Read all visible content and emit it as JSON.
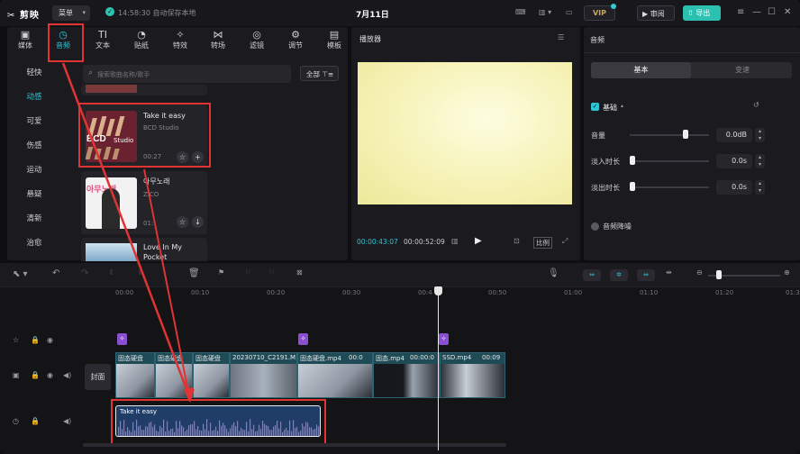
{
  "app": {
    "logo": "✂ 剪映",
    "menu": "菜单",
    "save_status": "14:58:30 自动保存本地",
    "title": "7月11日",
    "vip": "VIP",
    "review": "审阅",
    "export": "导出"
  },
  "tabs": [
    {
      "label": "媒体",
      "icon": "▣"
    },
    {
      "label": "音频",
      "icon": "◷"
    },
    {
      "label": "文本",
      "icon": "TI"
    },
    {
      "label": "贴纸",
      "icon": "◔"
    },
    {
      "label": "特效",
      "icon": "✧"
    },
    {
      "label": "转场",
      "icon": "⋈"
    },
    {
      "label": "滤镜",
      "icon": "◎"
    },
    {
      "label": "调节",
      "icon": "⚙"
    },
    {
      "label": "模板",
      "icon": "▤"
    }
  ],
  "categories": [
    "轻快",
    "动感",
    "可爱",
    "伤感",
    "运动",
    "悬疑",
    "清新",
    "治愈"
  ],
  "search": {
    "placeholder": "搜索歌曲名称/歌手",
    "filter": "全部"
  },
  "tracks": [
    {
      "title": "Take it easy",
      "artist": "BCD Studio",
      "duration": "00:27",
      "cover": "BCD"
    },
    {
      "title": "아무노래",
      "artist": "ZICO",
      "duration": "01:",
      "cover": "아무노래"
    },
    {
      "title": "Love In My Pocket",
      "artist": "",
      "duration": "",
      "cover": ""
    }
  ],
  "player": {
    "title": "播放器",
    "current": "00:00:43:07",
    "total": "00:00:52:09",
    "ratio": "比例"
  },
  "audio_panel": {
    "title": "音频",
    "tab_basic": "基本",
    "tab_voice": "变速",
    "section": "基础",
    "volume_label": "音量",
    "volume_value": "0.0dB",
    "fadein_label": "淡入时长",
    "fadein_value": "0.0s",
    "fadeout_label": "淡出时长",
    "fadeout_value": "0.0s",
    "denoise": "音频降噪",
    "volume_level": 0.7
  },
  "ruler": [
    "00:00",
    "00:10",
    "00:20",
    "00:30",
    "00:4",
    "00:50",
    "01:00",
    "01:10",
    "01:20",
    "01:30"
  ],
  "cover_label": "封面",
  "clips": [
    "固态硬盘",
    "固态硬盘",
    "固态硬盘",
    "20230710_C2191.M",
    "固态硬盘.mp4",
    "00:0",
    "固态.mp4",
    "00:00:0",
    "SSD.mp4",
    "00:09"
  ],
  "audio_clip": "Take it easy",
  "colors": {
    "accent": "#2fc4d6",
    "highlight": "#e03434",
    "export": "#2cc0b0"
  }
}
